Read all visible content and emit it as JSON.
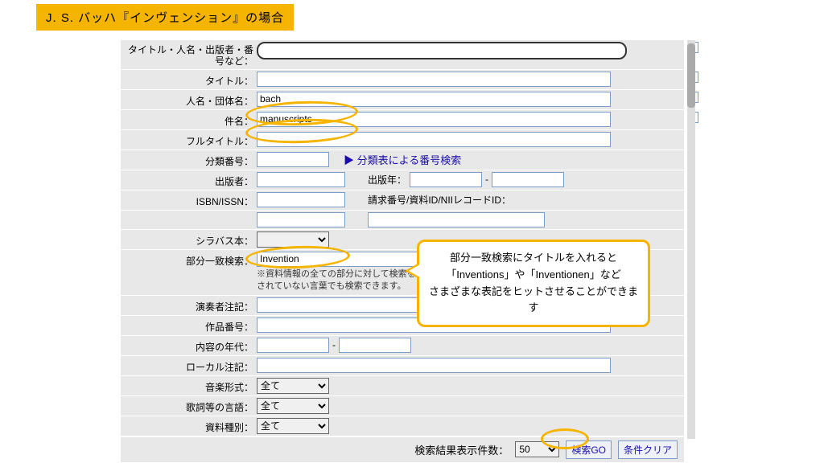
{
  "annotation": {
    "title": "J. S. バッハ『インヴェンション』の場合",
    "callout": {
      "line1": "部分一致検索にタイトルを入れると",
      "line2": "「Inventions」や「Inventionen」など",
      "line3": "さまざまな表記をヒットさせることができます"
    }
  },
  "labels": {
    "keyword": "タイトル・人名・出版者・番号など：",
    "title": "タイトル：",
    "name": "人名・団体名：",
    "subject": "件名：",
    "fulltitle": "フルタイトル：",
    "classno": "分類番号：",
    "classlink": "▶ 分類表による番号検索",
    "publisher": "出版者：",
    "pubyear": "出版年：",
    "isbn": "ISBN/ISSN：",
    "callno": "請求番号/資料ID/NIIレコードID：",
    "syllabus": "シラバス本：",
    "partial": "部分一致検索：",
    "note1": "※資料情報の全ての部分に対して検索を行います。キーワードに登録",
    "note2": "されていない言葉でも検索できます。",
    "performer": "演奏者注記：",
    "opus": "作品番号：",
    "date": "内容の年代：",
    "localnote": "ローカル注記：",
    "form": "音楽形式：",
    "lang": "歌詞等の言語：",
    "material": "資料種別：",
    "results": "検索結果表示件数：",
    "dash": "-"
  },
  "values": {
    "name": "bach",
    "subject": "manuscripts",
    "partial": "Invention",
    "select_all": "全て",
    "count": "50"
  },
  "buttons": {
    "go": "検索GO",
    "clear": "条件クリア"
  }
}
